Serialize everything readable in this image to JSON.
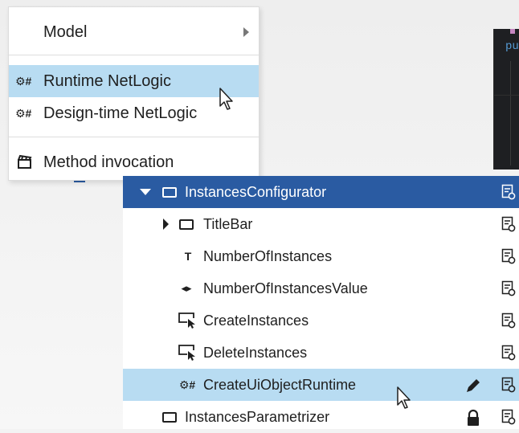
{
  "code_editor": {
    "text": "pu"
  },
  "context_menu": {
    "items": [
      {
        "label": "Model",
        "icon": "none",
        "has_submenu": true,
        "highlighted": false
      },
      {
        "label": "Runtime NetLogic",
        "icon": "netlogic-icon",
        "has_submenu": false,
        "highlighted": true
      },
      {
        "label": "Design-time NetLogic",
        "icon": "netlogic-icon",
        "has_submenu": false,
        "highlighted": false
      },
      {
        "label": "Method invocation",
        "icon": "clapperboard-icon",
        "has_submenu": false,
        "highlighted": false
      }
    ],
    "icon_glyph": "⚙#"
  },
  "tree": {
    "rows": [
      {
        "label": "InstancesConfigurator",
        "icon": "panel-icon",
        "expanded": true,
        "selected_header": true
      },
      {
        "label": "TitleBar",
        "icon": "panel-icon",
        "expanded": false
      },
      {
        "label": "NumberOfInstances",
        "icon": "text-icon"
      },
      {
        "label": "NumberOfInstancesValue",
        "icon": "spinbox-icon"
      },
      {
        "label": "CreateInstances",
        "icon": "button-icon"
      },
      {
        "label": "DeleteInstances",
        "icon": "button-icon"
      },
      {
        "label": "CreateUiObjectRuntime",
        "icon": "netlogic-icon",
        "highlighted": true,
        "action": "edit"
      },
      {
        "label": "InstancesParametrizer",
        "icon": "panel-icon",
        "action": "locked"
      }
    ],
    "glyphs": {
      "text": "T",
      "spinbox": "◂▸",
      "netlogic": "⚙#"
    }
  },
  "colors": {
    "header_bg": "#2a5ba2",
    "highlight_bg": "#b8dcf2"
  }
}
